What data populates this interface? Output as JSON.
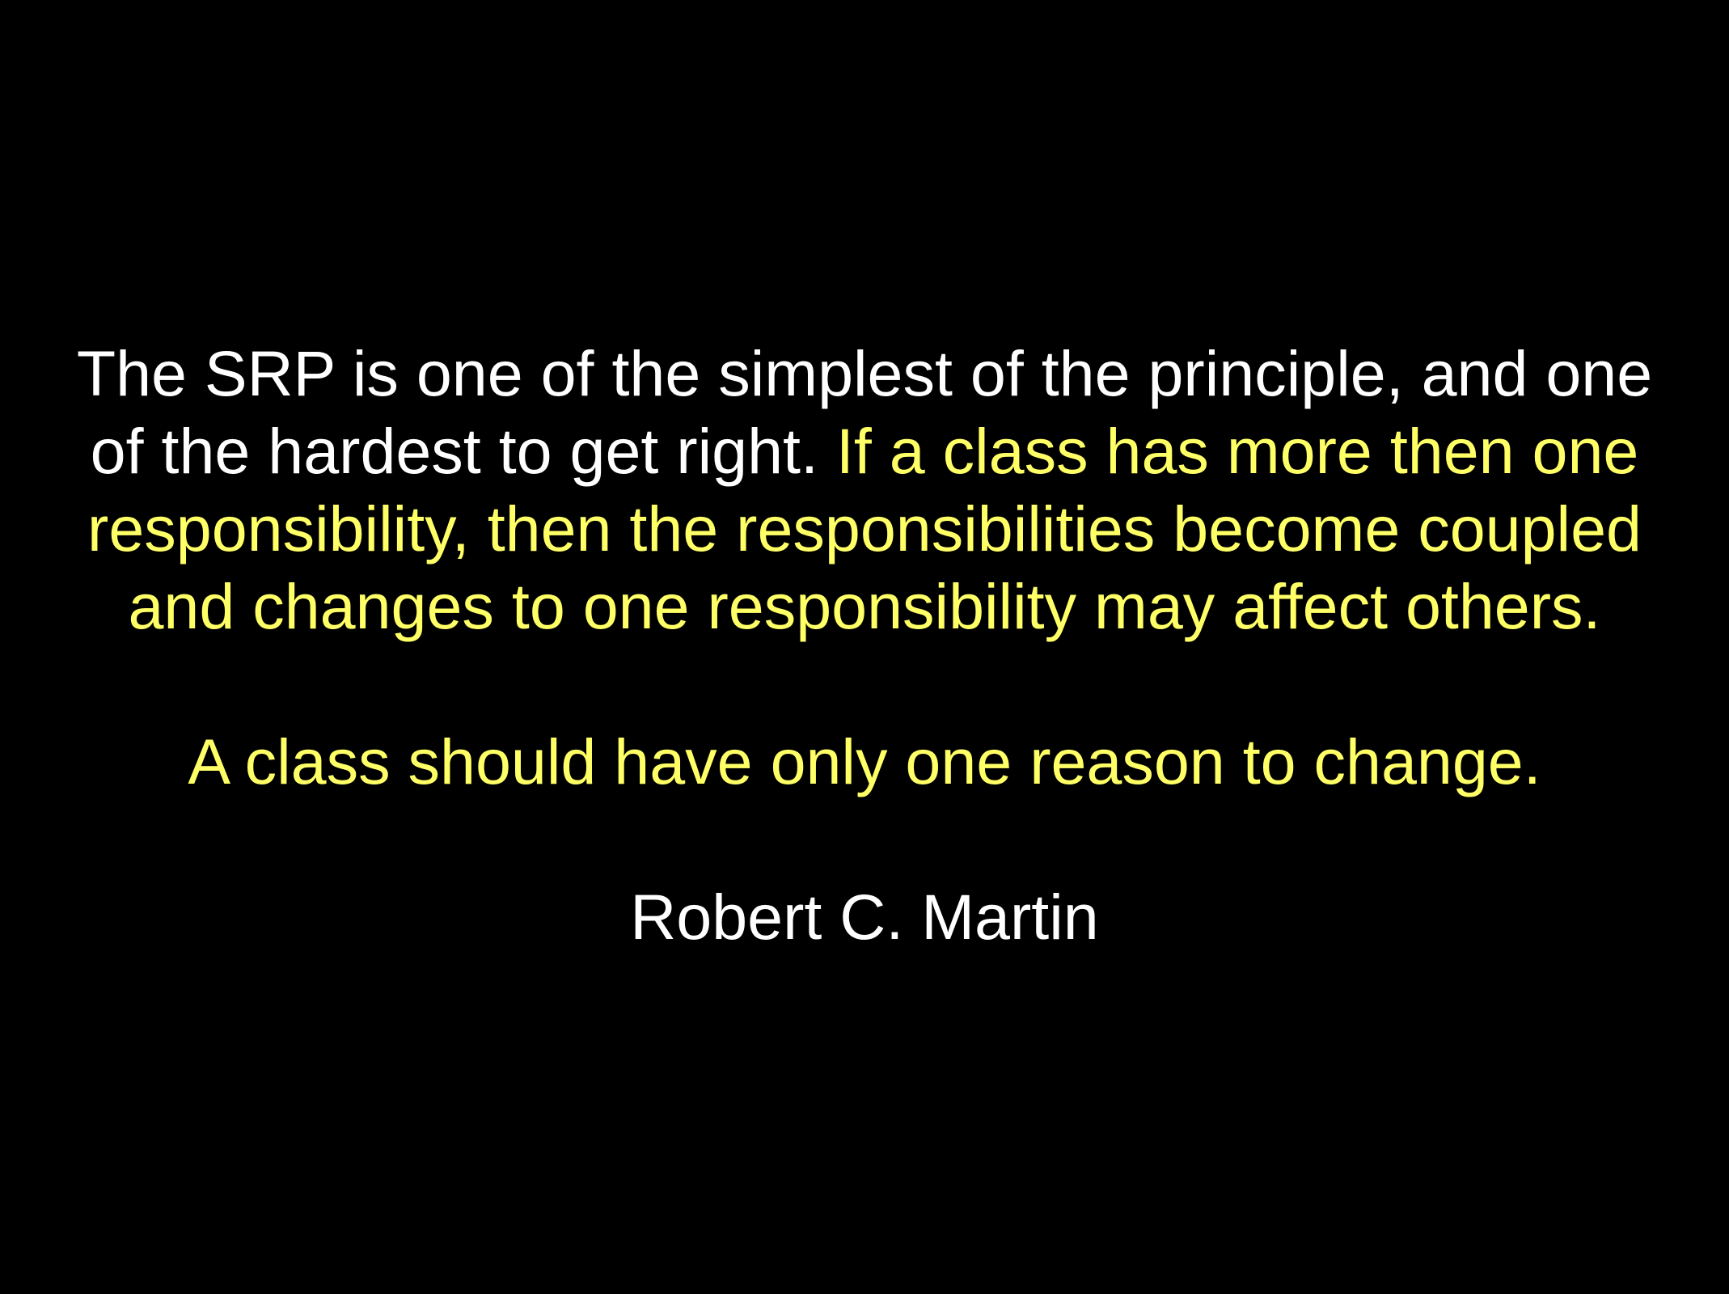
{
  "slide": {
    "quote": {
      "line1": "The SRP is one of the simplest of the principle, and one",
      "line2_white": "of the hardest to get right. ",
      "line2_yellow": "If a class has more then one",
      "line3": "responsibility, then the responsibilities become coupled",
      "line4": "and changes to one responsibility may affect others.",
      "principle": "A class should have only one reason to change."
    },
    "attribution": "Robert C. Martin"
  },
  "colors": {
    "background": "#000000",
    "text_white": "#ffffff",
    "text_yellow": "#ffff66"
  }
}
